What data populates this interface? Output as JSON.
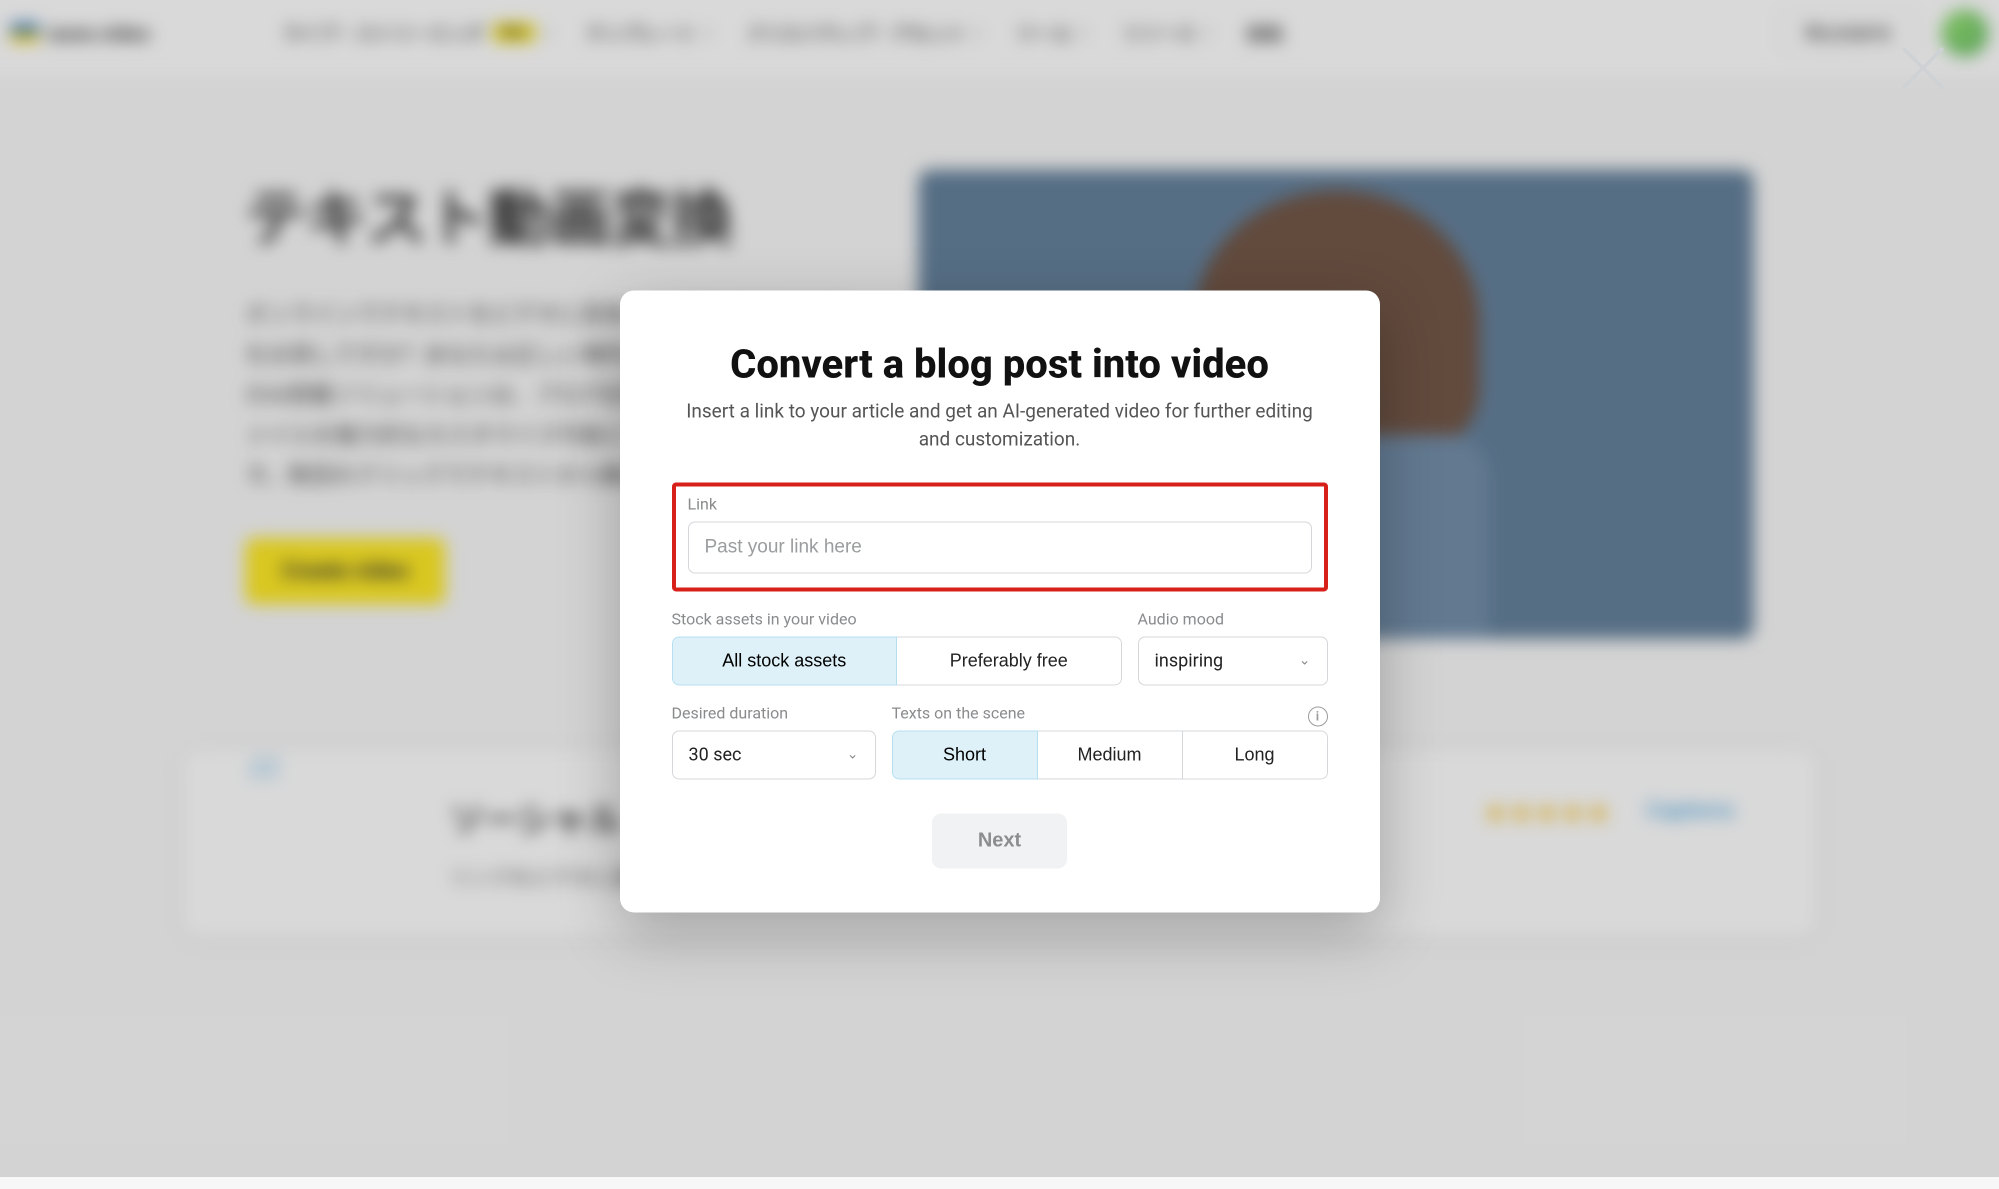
{
  "nav": {
    "brand": "wave.video",
    "items": [
      {
        "label": "ライブ・ストリーミング",
        "badge": "New"
      },
      {
        "label": "テンプレート"
      },
      {
        "label": "クリエイティブ・アセット"
      },
      {
        "label": "ツール"
      },
      {
        "label": "リソース"
      },
      {
        "label": "価格"
      }
    ],
    "my_projects": "My projects"
  },
  "hero": {
    "title": "テキスト動画変換",
    "body": "オンラインでテキストをビデオに変換する簡単で迅速な方法をお探しですか？あなたは正しい場所にいます！Wave.videoのAI搭載ソリューションは、ブログ記事、記事、テキストファイルを魅力的なカスタマイズ可能ビデオに素早く変換します。数回のクリックでテキストから動画を作成。",
    "cta": "Create video"
  },
  "testimonial": {
    "heading": "ソーシャル",
    "body": "リンクをビデオに変換してソーシャルで共有する。テンプレートから始められる。",
    "source": "Capterra"
  },
  "modal": {
    "title": "Convert a blog post into video",
    "subtitle": "Insert a link to your article and get an AI-generated video for further editing and customization.",
    "link_label": "Link",
    "link_placeholder": "Past your link here",
    "stock_label": "Stock assets in your video",
    "stock_options": {
      "all": "All stock assets",
      "free": "Preferably free"
    },
    "audio_label": "Audio mood",
    "audio_value": "inspiring",
    "duration_label": "Desired duration",
    "duration_value": "30 sec",
    "texts_label": "Texts on the scene",
    "texts_options": {
      "short": "Short",
      "medium": "Medium",
      "long": "Long"
    },
    "next": "Next"
  }
}
